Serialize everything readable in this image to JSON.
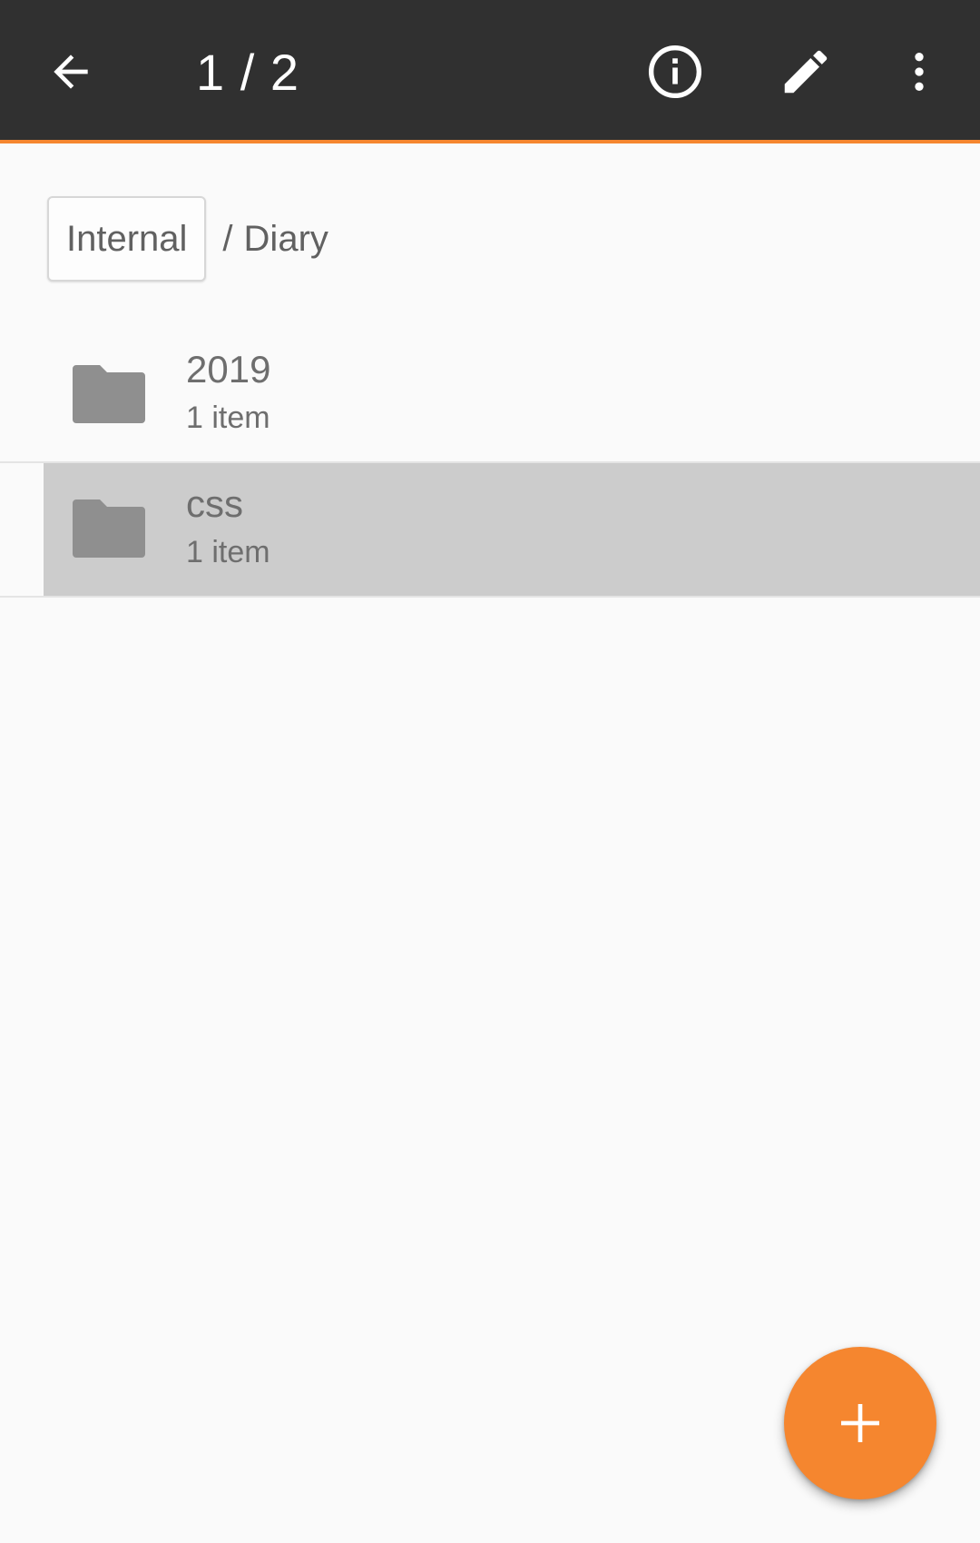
{
  "toolbar": {
    "title": "1 / 2",
    "icons": {
      "back": "arrow-back-icon",
      "info": "info-icon",
      "edit": "pencil-icon",
      "more": "more-vert-icon"
    },
    "accent_color": "#f5862f",
    "background_color": "#303030"
  },
  "breadcrumb": {
    "root": "Internal",
    "separator": "/",
    "current": "Diary"
  },
  "files": [
    {
      "name": "2019",
      "meta": "1 item",
      "icon": "folder-icon",
      "selected": false
    },
    {
      "name": "css",
      "meta": "1 item",
      "icon": "folder-icon",
      "selected": true
    }
  ],
  "fab": {
    "icon": "plus-icon",
    "color": "#f5862f"
  }
}
